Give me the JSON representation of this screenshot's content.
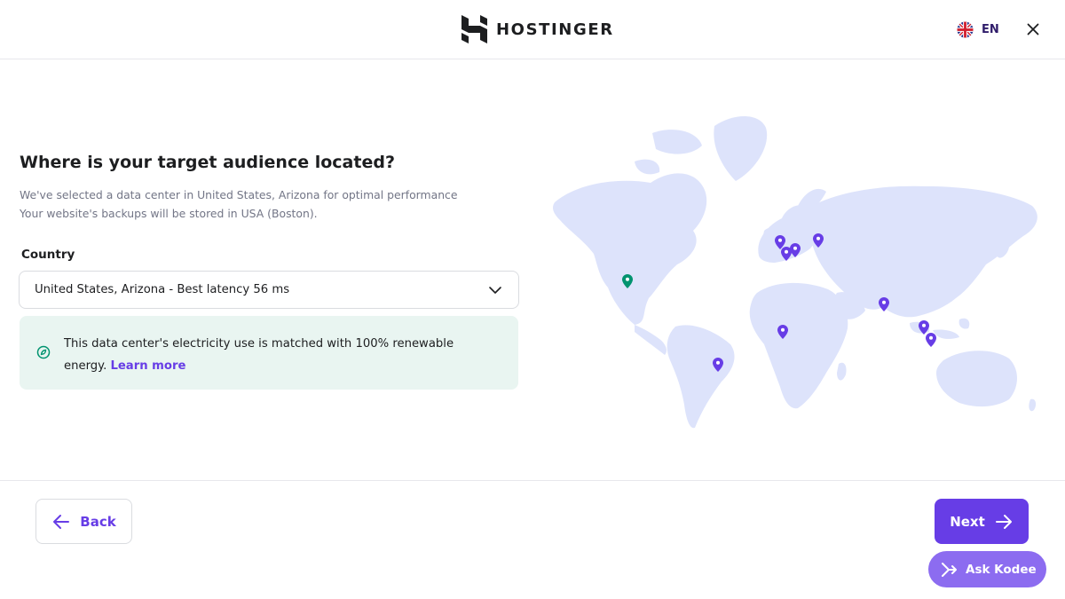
{
  "header": {
    "brand": "HOSTINGER",
    "language": "EN"
  },
  "main": {
    "title": "Where is your target audience located?",
    "subtitle_line1": "We've selected a data center in United States, Arizona for optimal performance",
    "subtitle_line2": "Your website's backups will be stored in USA (Boston).",
    "country_label": "Country",
    "country_value": "United States, Arizona - Best latency 56 ms",
    "notice_text": "This data center's electricity use is matched with 100% renewable energy.",
    "notice_link": "Learn more"
  },
  "map": {
    "pins": [
      {
        "name": "map-pin-selected",
        "status": "selected",
        "color": "#00936f"
      },
      {
        "name": "map-pin",
        "status": "available",
        "color": "#673de6"
      }
    ]
  },
  "footer": {
    "back_label": "Back",
    "next_label": "Next",
    "assistant_label": "Ask Kodee"
  },
  "colors": {
    "accent": "#673de6",
    "selected_pin": "#00936f",
    "notice_bg": "#e9f5f1",
    "map_land": "#dde3fb",
    "text": "#1d1e20",
    "muted": "#727586"
  }
}
